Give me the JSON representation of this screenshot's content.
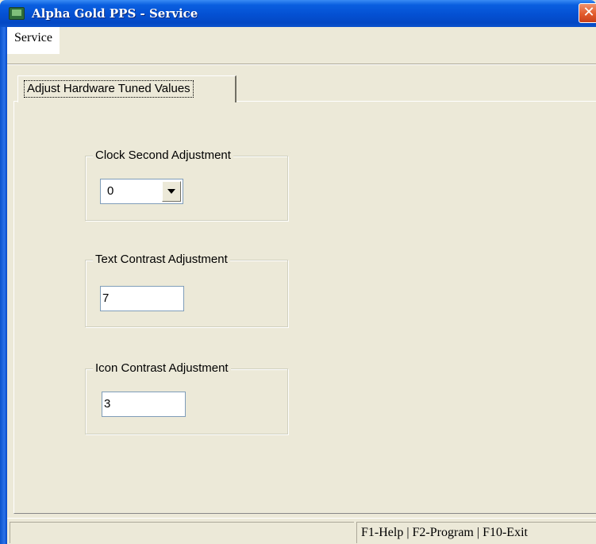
{
  "window": {
    "title": "Alpha Gold PPS - Service",
    "title_bar_color": "#0450d2",
    "close_icon": "close-icon"
  },
  "menu": {
    "items": [
      "Service"
    ]
  },
  "tabs": [
    {
      "label": "Adjust Hardware Tuned Values",
      "selected": true
    }
  ],
  "groups": {
    "clock": {
      "title": "Clock Second Adjustment",
      "value": "0"
    },
    "text_contrast": {
      "title": "Text Contrast Adjustment",
      "value": "7"
    },
    "icon_contrast": {
      "title": "Icon Contrast Adjustment",
      "value": "3"
    }
  },
  "statusbar": {
    "left_text": "",
    "right_text": "F1-Help | F2-Program | F10-Exit"
  }
}
